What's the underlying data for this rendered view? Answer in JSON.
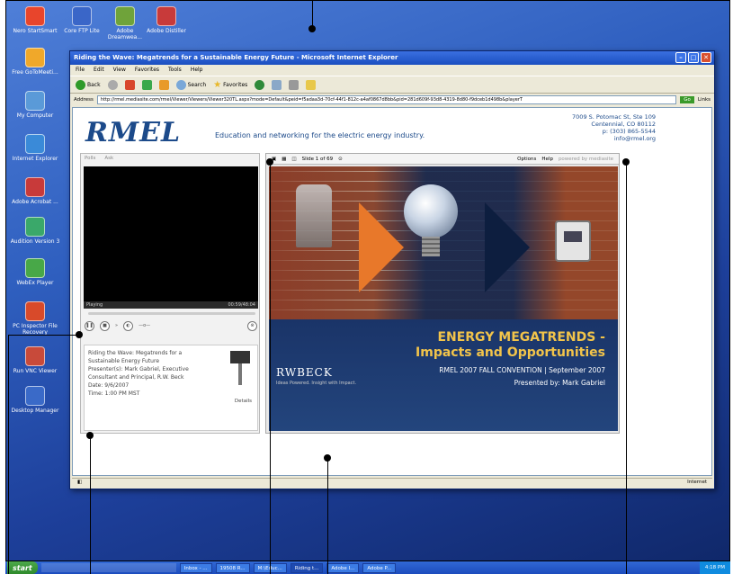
{
  "desktop": {
    "icons": [
      {
        "label": "Nero StartSmart",
        "color": "#e8452c"
      },
      {
        "label": "Core FTP Lite",
        "color": "#3a66c8"
      },
      {
        "label": "Adobe Dreamwea...",
        "color": "#6fa33a"
      },
      {
        "label": "Adobe Distiller",
        "color": "#c83a3a"
      },
      {
        "label": "Free GoToMeeti...",
        "color": "#f0a82a"
      },
      {
        "label": "My Computer",
        "color": "#5a9ad8"
      },
      {
        "label": "Internet Explorer",
        "color": "#3a8ad8"
      },
      {
        "label": "Adobe Acrobat ...",
        "color": "#c83a3a"
      },
      {
        "label": "Audition Version 3",
        "color": "#3aa86a"
      },
      {
        "label": "WebEx Player",
        "color": "#48a848"
      },
      {
        "label": "PC Inspector File Recovery",
        "color": "#d84a2a"
      },
      {
        "label": "Run VNC Viewer",
        "color": "#c84a3a"
      },
      {
        "label": "Desktop Manager",
        "color": "#3a6ac8"
      }
    ]
  },
  "window": {
    "title": "Riding the Wave: Megatrends for a Sustainable Energy Future - Microsoft Internet Explorer",
    "menu": [
      "File",
      "Edit",
      "View",
      "Favorites",
      "Tools",
      "Help"
    ],
    "toolbar": {
      "back": "Back",
      "search": "Search",
      "favorites": "Favorites"
    },
    "address_label": "Address",
    "url": "http://rmel.mediasite.com/rmel/Viewer/Viewers/Viewer320TL.aspx?mode=Default&peid=f5adaa3d-70cf-44f1-812c-a4af0867d8bb&pid=281d609f-93d8-4319-8d80-f9dceb1d498b&playerT",
    "go": "Go",
    "links": "Links",
    "status_right": "Internet"
  },
  "page": {
    "logo": "RMEL",
    "tagline": "Education and networking for the electric energy industry.",
    "address_lines": [
      "7009 S. Potomac St, Ste 109",
      "Centennial, CO 80112",
      "p: (303) 865-5544",
      "info@rmel.org"
    ],
    "player_tabs": [
      "Polls",
      "Ask"
    ],
    "player_status": "Playing",
    "player_time": "00:59/48:04",
    "info_title": "Riding the Wave: Megatrends for a Sustainable Energy Future",
    "presenter": "Presenter(s): Mark Gabriel, Executive Consultant and Principal, R.W. Beck",
    "date": "Date: 9/6/2007",
    "time": "Time: 1:00 PM MST",
    "details": "Details",
    "slide_counter": "Slide 1 of 69",
    "options": "Options",
    "help": "Help",
    "powered": "powered by mediasite",
    "slide": {
      "title_line1": "ENERGY MEGATRENDS -",
      "title_line2": "Impacts and Opportunities",
      "convention": "RMEL 2007 FALL CONVENTION | September 2007",
      "presented_by": "Presented by: Mark Gabriel",
      "brand": "RWBECK",
      "brand_tag": "Ideas Powered. Insight with Impact."
    }
  },
  "taskbar": {
    "start": "start",
    "tasks": [
      "Inbox - ...",
      "19508 R...",
      "M:\\Educ...",
      "Riding t...",
      "Adobe I...",
      "Adobe P..."
    ],
    "clock": "4:18 PM"
  }
}
